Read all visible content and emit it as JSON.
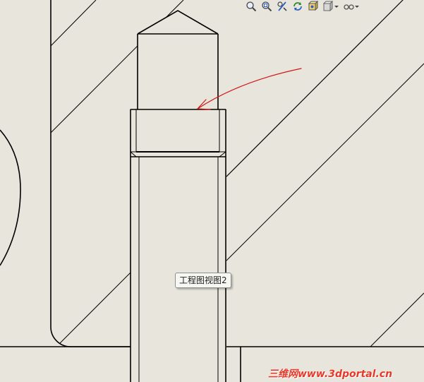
{
  "view": {
    "tooltip_text": "工程图视图2"
  },
  "toolbar": {
    "buttons": [
      {
        "name": "zoom-to-fit-icon"
      },
      {
        "name": "zoom-to-area-icon"
      },
      {
        "name": "zoom-in-out-icon"
      },
      {
        "name": "rotate-view-icon"
      },
      {
        "name": "view-orientation-icon"
      },
      {
        "name": "display-style-icon"
      },
      {
        "name": "hide-show-items-icon"
      }
    ]
  },
  "watermark": {
    "text": "三维网www.3dportal.cn"
  },
  "colors": {
    "background": "#e8e6dc",
    "geometry": "#000000",
    "annotation": "#d01818",
    "watermark": "#e53a2a"
  }
}
